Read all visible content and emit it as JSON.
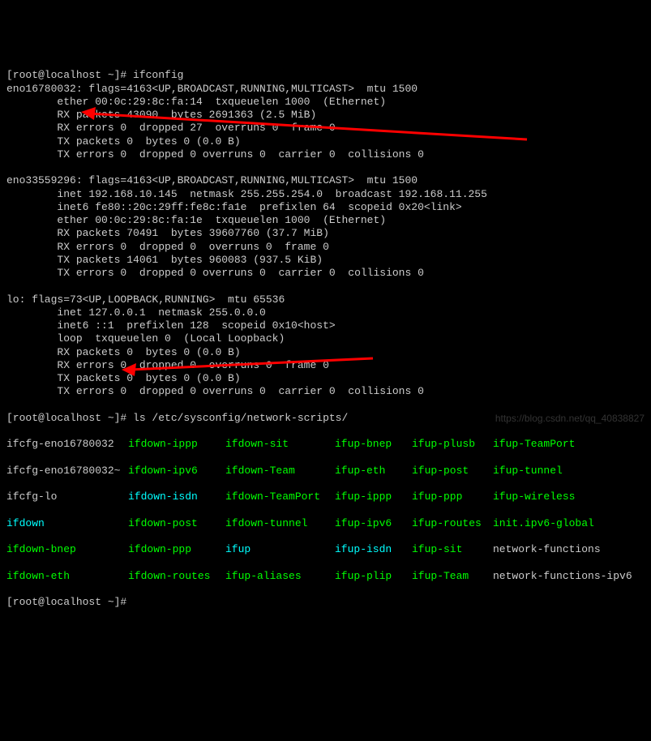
{
  "prompt1": "[root@localhost ~]# ifconfig",
  "if1": {
    "header": "eno16780032: flags=4163<UP,BROADCAST,RUNNING,MULTICAST>  mtu 1500",
    "ether": "        ether 00:0c:29:8c:fa:14  txqueuelen 1000  (Ethernet)",
    "rxp": "        RX packets 43090  bytes 2691363 (2.5 MiB)",
    "rxe": "        RX errors 0  dropped 27  overruns 0  frame 0",
    "txp": "        TX packets 0  bytes 0 (0.0 B)",
    "txe": "        TX errors 0  dropped 0 overruns 0  carrier 0  collisions 0"
  },
  "if2": {
    "header": "eno33559296: flags=4163<UP,BROADCAST,RUNNING,MULTICAST>  mtu 1500",
    "inet": "        inet 192.168.10.145  netmask 255.255.254.0  broadcast 192.168.11.255",
    "inet6": "        inet6 fe80::20c:29ff:fe8c:fa1e  prefixlen 64  scopeid 0x20<link>",
    "ether": "        ether 00:0c:29:8c:fa:1e  txqueuelen 1000  (Ethernet)",
    "rxp": "        RX packets 70491  bytes 39607760 (37.7 MiB)",
    "rxe": "        RX errors 0  dropped 0  overruns 0  frame 0",
    "txp": "        TX packets 14061  bytes 960083 (937.5 KiB)",
    "txe": "        TX errors 0  dropped 0 overruns 0  carrier 0  collisions 0"
  },
  "lo": {
    "header": "lo: flags=73<UP,LOOPBACK,RUNNING>  mtu 65536",
    "inet": "        inet 127.0.0.1  netmask 255.0.0.0",
    "inet6": "        inet6 ::1  prefixlen 128  scopeid 0x10<host>",
    "loop": "        loop  txqueuelen 0  (Local Loopback)",
    "rxp": "        RX packets 0  bytes 0 (0.0 B)",
    "rxe": "        RX errors 0  dropped 0  overruns 0  frame 0",
    "txp": "        TX packets 0  bytes 0 (0.0 B)",
    "txe": "        TX errors 0  dropped 0 overruns 0  carrier 0  collisions 0"
  },
  "prompt2": "[root@localhost ~]# ls /etc/sysconfig/network-scripts/",
  "ls": {
    "r1": {
      "c1": "ifcfg-eno16780032",
      "c2": "ifdown-ippp",
      "c3": "ifdown-sit",
      "c4": "ifup-bnep",
      "c5": "ifup-plusb",
      "c6": "ifup-TeamPort"
    },
    "r2": {
      "c1": "ifcfg-eno16780032~",
      "c2": "ifdown-ipv6",
      "c3": "ifdown-Team",
      "c4": "ifup-eth",
      "c5": "ifup-post",
      "c6": "ifup-tunnel"
    },
    "r3": {
      "c1": "ifcfg-lo",
      "c2": "ifdown-isdn",
      "c3": "ifdown-TeamPort",
      "c4": "ifup-ippp",
      "c5": "ifup-ppp",
      "c6": "ifup-wireless"
    },
    "r4": {
      "c1": "ifdown",
      "c2": "ifdown-post",
      "c3": "ifdown-tunnel",
      "c4": "ifup-ipv6",
      "c5": "ifup-routes",
      "c6": "init.ipv6-global"
    },
    "r5": {
      "c1": "ifdown-bnep",
      "c2": "ifdown-ppp",
      "c3": "ifup",
      "c4": "ifup-isdn",
      "c5": "ifup-sit",
      "c6": "network-functions"
    },
    "r6": {
      "c1": "ifdown-eth",
      "c2": "ifdown-routes",
      "c3": "ifup-aliases",
      "c4": "ifup-plip",
      "c5": "ifup-Team",
      "c6": "network-functions-ipv6"
    }
  },
  "prompt3": "[root@localhost ~]# ",
  "watermark": "https://blog.csdn.net/qq_40838827"
}
